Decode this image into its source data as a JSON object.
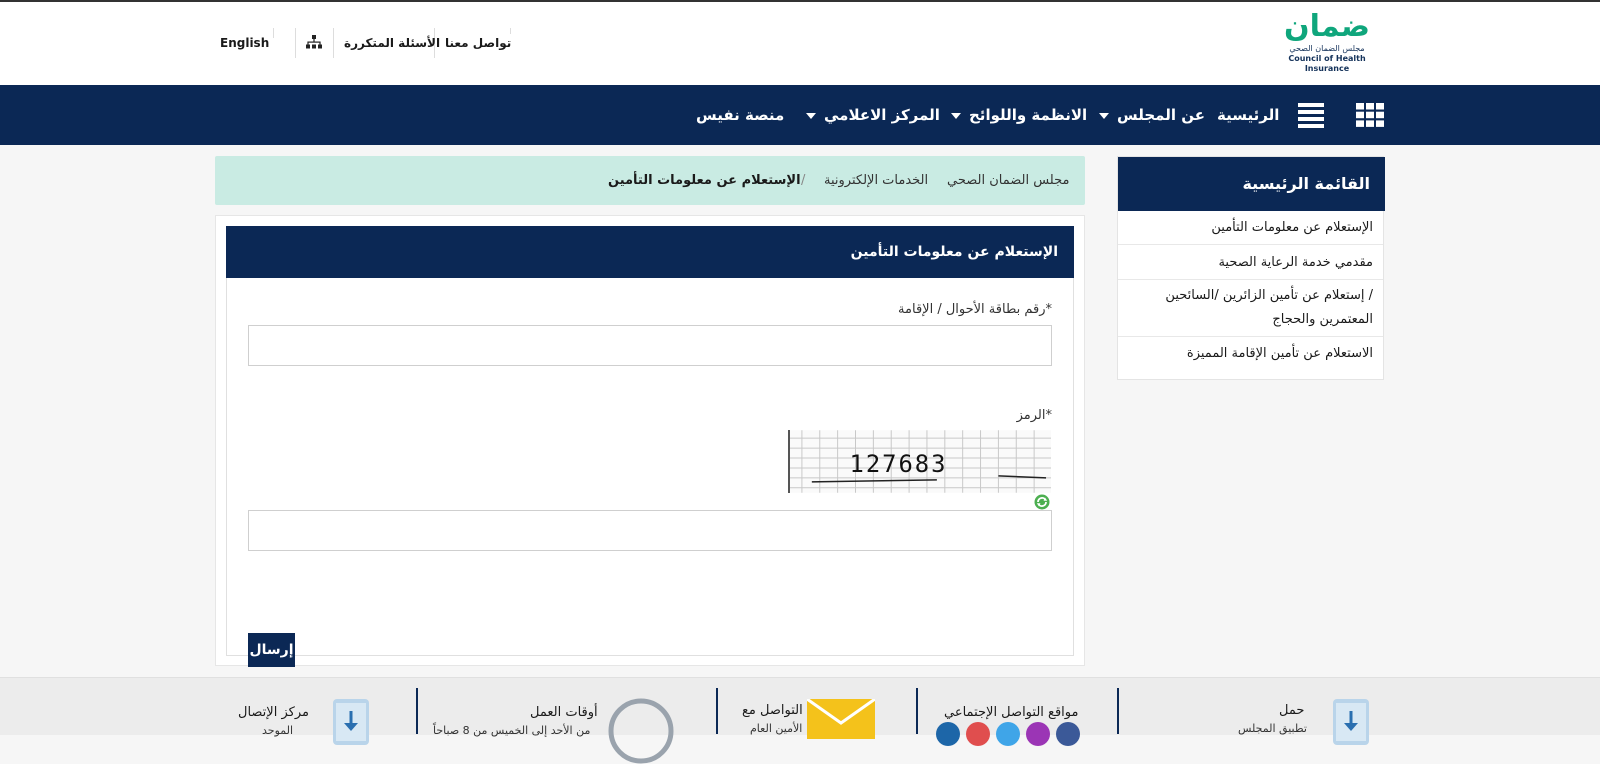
{
  "header": {
    "logo": {
      "word": "ضمان",
      "arabic": "مجلس الضمان الصحي",
      "english": "Council of Health Insurance"
    },
    "links": {
      "contact": "تواصل معنا",
      "faq": "الأسئلة المتكررة",
      "language": "English"
    }
  },
  "nav": {
    "home": "الرئيسية",
    "about": "عن المجلس",
    "regulations": "الانظمة واللوائح",
    "media": "المركز الاعلامي",
    "nafees": "منصة نفيس"
  },
  "sidebar": {
    "title": "القائمة الرئيسية",
    "items": [
      {
        "label": "الإستعلام عن معلومات التأمين"
      },
      {
        "label": "مقدمي خدمة الرعاية الصحية"
      },
      {
        "label_line1": "إستعلام عن تأمين الزائرين /السائحين /",
        "label_line2": "المعتمرين والحجاج"
      },
      {
        "label": "الاستعلام عن تأمين الإقامة المميزة"
      }
    ]
  },
  "breadcrumb": {
    "home": "مجلس الضمان الصحي",
    "section": "الخدمات الإلكترونية",
    "separator": "/",
    "current": "الإستعلام عن معلومات التأمين"
  },
  "form": {
    "title": "الإستعلام عن معلومات التأمين",
    "id_label": "رقم بطاقة الأحوال / الإقامة*",
    "id_value": "",
    "code_label": "الرمز*",
    "captcha_text": "127683",
    "code_value": "",
    "submit": "إرسال"
  },
  "footer": {
    "app_title": "حمل",
    "app_sub": "تطبيق المجلس",
    "social_title": "مواقع التواصل الإجتماعي",
    "contact_title": "التواصل مع",
    "contact_sub": "الأمين العام",
    "hours_title": "أوقات العمل",
    "hours_sub": "من الأحد إلى الخميس من 8 صباحاً",
    "call_title": "مركز الإتصال",
    "call_sub": "الموحد"
  },
  "colors": {
    "navy": "#0b2855",
    "mint": "#c9ebe3",
    "brand_green": "#0fa67c"
  }
}
